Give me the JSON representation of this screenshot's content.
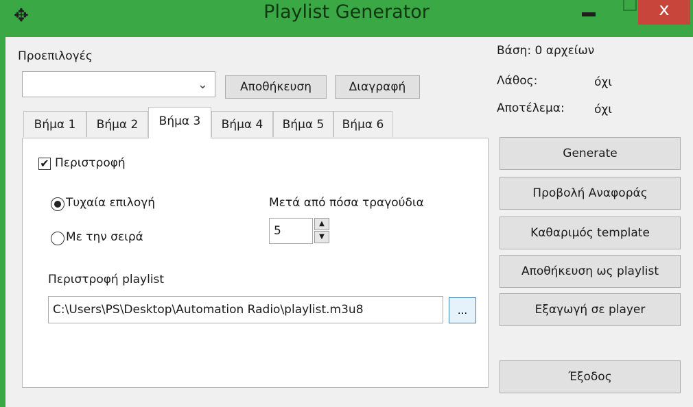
{
  "window": {
    "title": "Playlist Generator",
    "close_glyph": "x",
    "app_icon": "app-icon"
  },
  "presets": {
    "label": "Προεπιλογές",
    "combo_value": "",
    "save_label": "Αποθήκευση",
    "delete_label": "Διαγραφή"
  },
  "status": {
    "base": "Βάση: 0 αρχείων",
    "error_label": "Λάθος:",
    "error_value": "όχι",
    "result_label": "Αποτέλεμα:",
    "result_value": "όχι"
  },
  "tabs": [
    "Βήμα 1",
    "Βήμα 2",
    "Βήμα 3",
    "Βήμα 4",
    "Βήμα 5",
    "Βήμα 6"
  ],
  "active_tab": "Βήμα 3",
  "step3": {
    "rotation_label": "Περιστροφή",
    "rotation_checked": true,
    "random_label": "Τυχαία επιλογή",
    "order_label": "Με την σειρά",
    "selected_mode": "random",
    "after_songs_label": "Μετά από πόσα τραγούδια",
    "after_songs_value": "5",
    "playlist_label": "Περιστροφή playlist",
    "playlist_path": "C:\\Users\\PS\\Desktop\\Automation Radio\\playlist.m3u8",
    "browse_label": "..."
  },
  "actions": {
    "generate": "Generate",
    "view_report": "Προβολή Αναφοράς",
    "clear_template": "Καθαριμός template",
    "save_as_playlist": "Αποθήκευση ως playlist",
    "export_player": "Εξαγωγή σε player",
    "exit": "Έξοδος"
  },
  "colors": {
    "titlebar": "#3aa845",
    "close": "#c7453a",
    "window_bg": "#f0f0f0"
  }
}
